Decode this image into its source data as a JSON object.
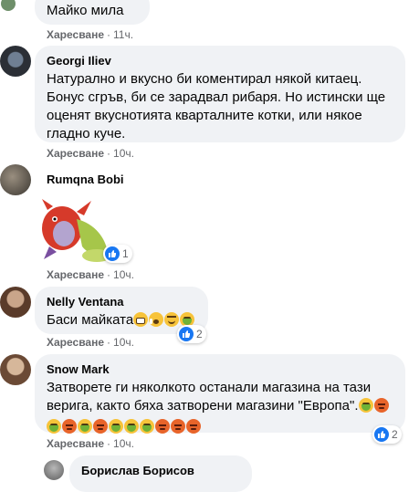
{
  "comments": [
    {
      "author": "",
      "text": "Майко мила",
      "like_label": "Харесване",
      "separator": "·",
      "time": "11ч."
    },
    {
      "author": "Georgi Iliev",
      "text": "Натурално и вкусно би коментирал някой китаец. Бонус сгръв, би се зарадвал рибаря. Но истински ще оценят вкуснотията кварталните котки, или някое гладно куче.",
      "like_label": "Харесване",
      "separator": "·",
      "time": "10ч."
    },
    {
      "author": "Rumqna Bobi",
      "sticker": "dragon-sticker",
      "like_label": "Харесване",
      "separator": "·",
      "time": "10ч.",
      "reaction_count": "1"
    },
    {
      "author": "Nelly Ventana",
      "text": "Баси майката",
      "emojis": [
        "grin-sweat",
        "shocked",
        "woozy",
        "nauseated"
      ],
      "like_label": "Харесване",
      "separator": "·",
      "time": "10ч.",
      "reaction_count": "2"
    },
    {
      "author": "Snow Mark",
      "text": "Затворете ги няколкото останали магазина на тази верига, както бяха затворени магазини \"Европа\".",
      "emojis_line1": [
        "nauseated",
        "angry"
      ],
      "emojis_line2": [
        "nauseated",
        "angry",
        "nauseated",
        "angry",
        "nauseated",
        "nauseated",
        "nauseated",
        "angry",
        "angry",
        "angry"
      ],
      "like_label": "Харесване",
      "separator": "·",
      "time": "10ч.",
      "reaction_count": "2"
    },
    {
      "author": "Борислав Борисов"
    }
  ],
  "colors": {
    "bubble": "#f0f2f5",
    "meta": "#65676b",
    "like_blue": "#1877f2"
  }
}
